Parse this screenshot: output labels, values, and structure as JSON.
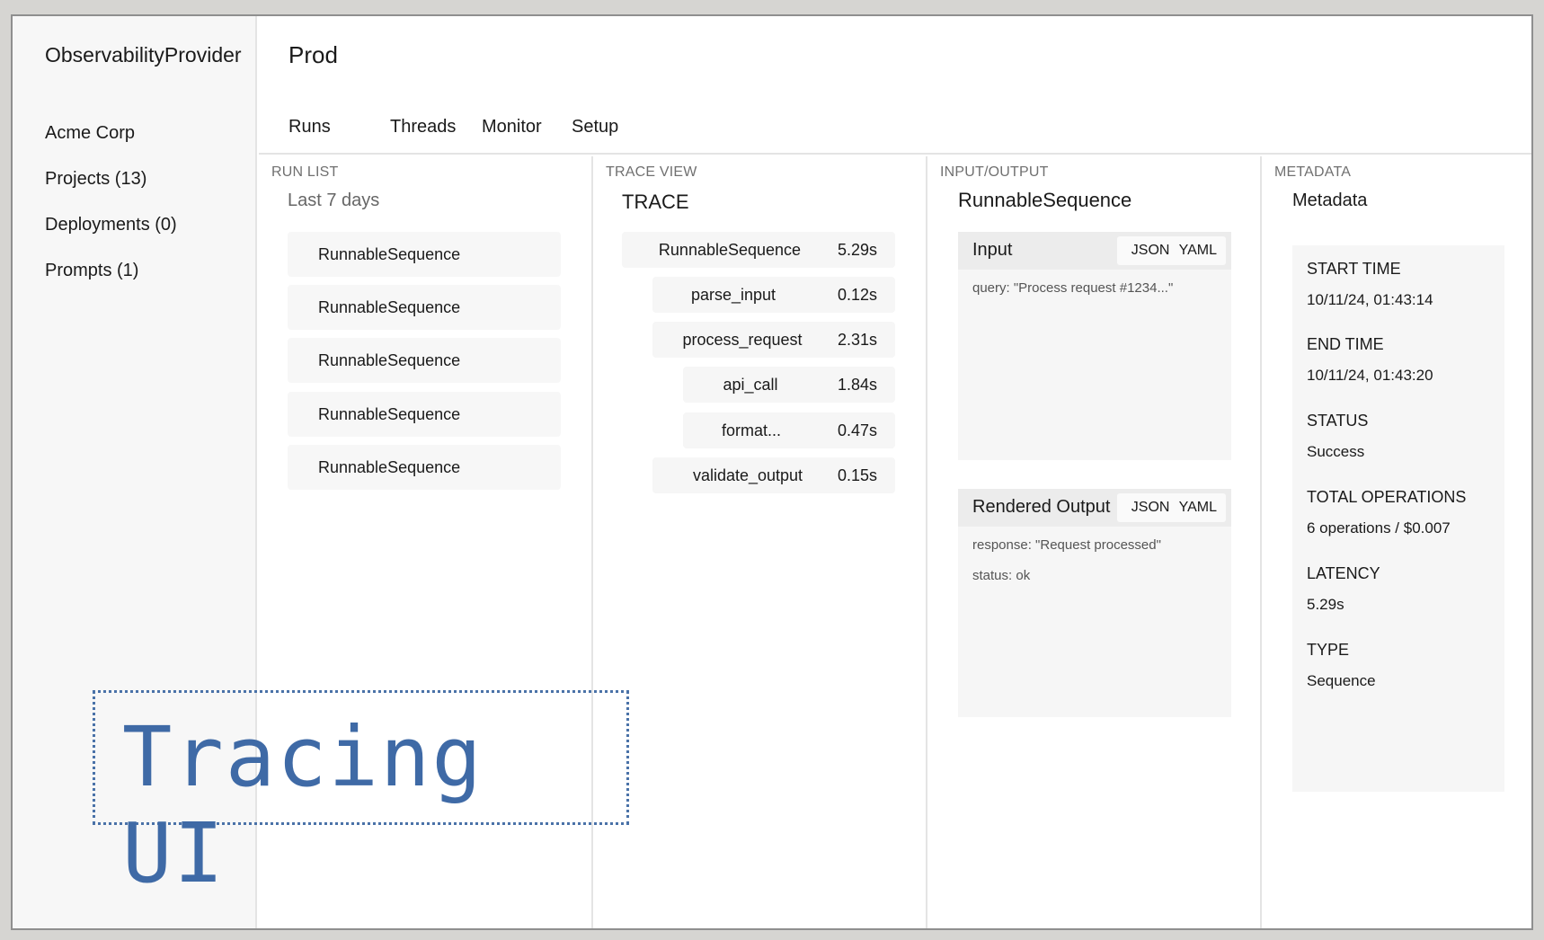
{
  "sidebar": {
    "brand": "ObservabilityProvider",
    "items": [
      {
        "label": "Acme Corp"
      },
      {
        "label": "Projects (13)"
      },
      {
        "label": "Deployments (0)"
      },
      {
        "label": "Prompts (1)"
      }
    ]
  },
  "header": {
    "title": "Prod",
    "tabs": [
      {
        "label": "Runs"
      },
      {
        "label": "Threads"
      },
      {
        "label": "Monitor"
      },
      {
        "label": "Setup"
      }
    ]
  },
  "run_list": {
    "label": "RUN LIST",
    "filter": "Last 7 days",
    "runs": [
      {
        "name": "RunnableSequence"
      },
      {
        "name": "RunnableSequence"
      },
      {
        "name": "RunnableSequence"
      },
      {
        "name": "RunnableSequence"
      },
      {
        "name": "RunnableSequence"
      }
    ]
  },
  "trace_view": {
    "label": "TRACE VIEW",
    "heading": "TRACE",
    "spans": [
      {
        "name": "RunnableSequence",
        "duration": "5.29s",
        "depth": 0
      },
      {
        "name": "parse_input",
        "duration": "0.12s",
        "depth": 1
      },
      {
        "name": "process_request",
        "duration": "2.31s",
        "depth": 1
      },
      {
        "name": "api_call",
        "duration": "1.84s",
        "depth": 2
      },
      {
        "name": "format...",
        "duration": "0.47s",
        "depth": 2
      },
      {
        "name": "validate_output",
        "duration": "0.15s",
        "depth": 1
      }
    ]
  },
  "io": {
    "label": "INPUT/OUTPUT",
    "heading": "RunnableSequence",
    "input": {
      "title": "Input",
      "format_json": "JSON",
      "format_yaml": "YAML",
      "lines": [
        "query: \"Process request #1234...\""
      ]
    },
    "output": {
      "title": "Rendered Output",
      "format_json": "JSON",
      "format_yaml": "YAML",
      "lines": [
        "response: \"Request processed\"",
        "status: ok"
      ]
    }
  },
  "metadata": {
    "label": "METADATA",
    "heading": "Metadata",
    "fields": [
      {
        "label": "START TIME",
        "value": "10/11/24, 01:43:14"
      },
      {
        "label": "END TIME",
        "value": "10/11/24, 01:43:20"
      },
      {
        "label": "STATUS",
        "value": "Success"
      },
      {
        "label": "TOTAL OPERATIONS",
        "value": "6 operations / $0.007"
      },
      {
        "label": "LATENCY",
        "value": "5.29s"
      },
      {
        "label": "TYPE",
        "value": "Sequence"
      }
    ]
  },
  "overlay": {
    "text": "Tracing UI",
    "color": "#3f6aa6"
  }
}
